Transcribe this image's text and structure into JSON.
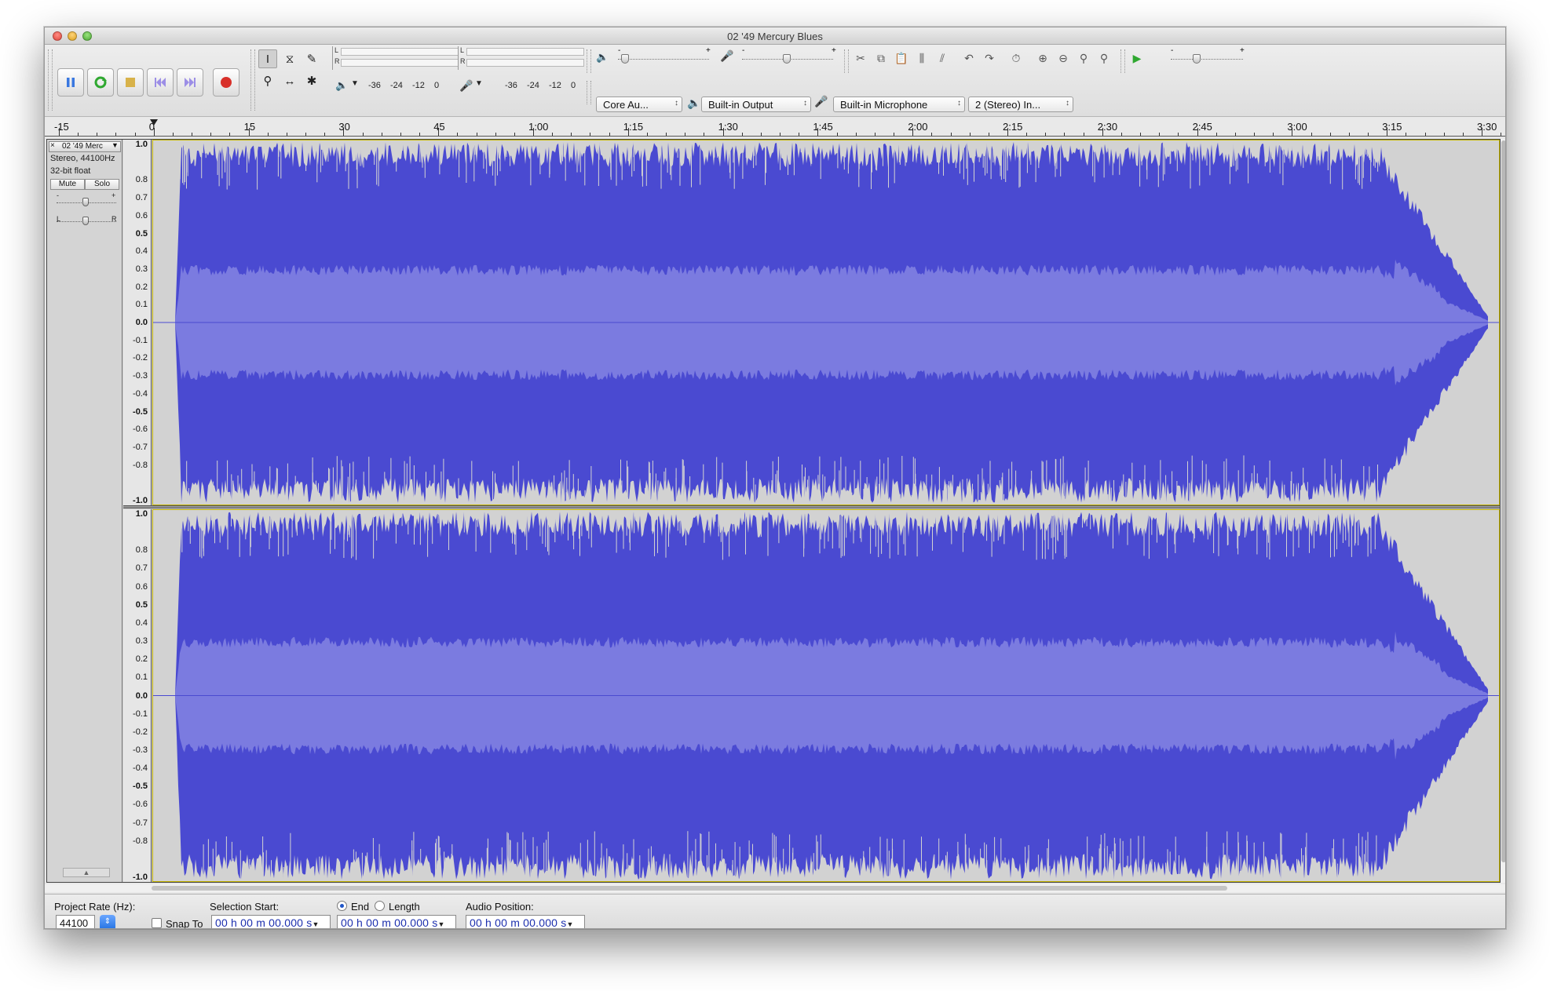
{
  "window": {
    "title": "02 '49 Mercury Blues"
  },
  "transport": {
    "pause_icon": "pause-icon",
    "play_icon": "play-icon",
    "stop_icon": "stop-icon",
    "skip_start_icon": "skip-start-icon",
    "skip_end_icon": "skip-end-icon",
    "record_icon": "record-icon"
  },
  "meters": {
    "play_labels": [
      "L",
      "R"
    ],
    "rec_labels": [
      "L",
      "R"
    ],
    "play_scale": [
      "-36",
      "-24",
      "-12",
      "0"
    ],
    "rec_scale": [
      "-36",
      "-24",
      "-12",
      "0"
    ]
  },
  "mixer": {
    "output_minus": "-",
    "output_plus": "+",
    "input_minus": "-",
    "input_plus": "+",
    "speed_minus": "-",
    "speed_plus": "+"
  },
  "devices": {
    "host": "Core Au...",
    "output": "Built-in Output",
    "input": "Built-in Microphone",
    "channels": "2 (Stereo) In..."
  },
  "ruler": {
    "labels": [
      "-15",
      "0",
      "15",
      "30",
      "45",
      "1:00",
      "1:15",
      "1:30",
      "1:45",
      "2:00",
      "2:15",
      "2:30",
      "2:45",
      "3:00",
      "3:15",
      "3:30"
    ]
  },
  "track": {
    "name": "02 '49 Merc",
    "close": "×",
    "menu": "▼",
    "info_rate": "Stereo, 44100Hz",
    "info_format": "32-bit float",
    "mute": "Mute",
    "solo": "Solo",
    "gain_minus": "-",
    "gain_plus": "+",
    "pan_left": "L",
    "pan_right": "R",
    "collapse": "▲"
  },
  "amp_scale": [
    "1.0",
    "0.8",
    "0.7",
    "0.6",
    "0.5",
    "0.4",
    "0.3",
    "0.2",
    "0.1",
    "0.0",
    "-0.1",
    "-0.2",
    "-0.3",
    "-0.4",
    "-0.5",
    "-0.6",
    "-0.7",
    "-0.8",
    "-1.0"
  ],
  "waveform_colors": {
    "peak": "#4a4ad1",
    "rms": "#7b7be0",
    "background": "#d2d2d2",
    "selection_border": "#c4b400"
  },
  "selection_bar": {
    "project_rate_label": "Project Rate (Hz):",
    "project_rate": "44100",
    "snap_to": "Snap To",
    "selection_start_label": "Selection Start:",
    "end_label": "End",
    "length_label": "Length",
    "audio_position_label": "Audio Position:",
    "selection_start": "00 h 00 m 00.000 s",
    "selection_end": "00 h 00 m 00.000 s",
    "audio_position": "00 h 00 m 00.000 s"
  }
}
